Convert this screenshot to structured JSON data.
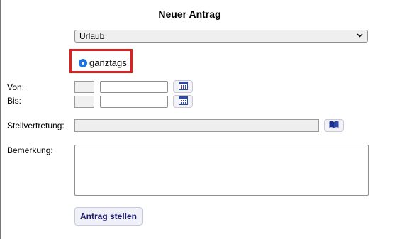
{
  "form": {
    "title": "Neuer Antrag",
    "type_select": {
      "value": "Urlaub",
      "chevron": "⌄"
    },
    "radio": {
      "label": "ganztags",
      "checked": true
    },
    "von": {
      "label": "Von:",
      "value": ""
    },
    "bis": {
      "label": "Bis:",
      "value": ""
    },
    "vertretung": {
      "label": "Stellvertretung:",
      "value": ""
    },
    "bemerkung": {
      "label": "Bemerkung:",
      "value": ""
    },
    "submit_label": "Antrag stellen",
    "icons": {
      "calendar": "calendar-icon",
      "addressbook": "book-icon"
    },
    "colors": {
      "highlight": "#e0201f",
      "radio": "#1a73e8",
      "button_text": "#1d1d6e"
    }
  }
}
